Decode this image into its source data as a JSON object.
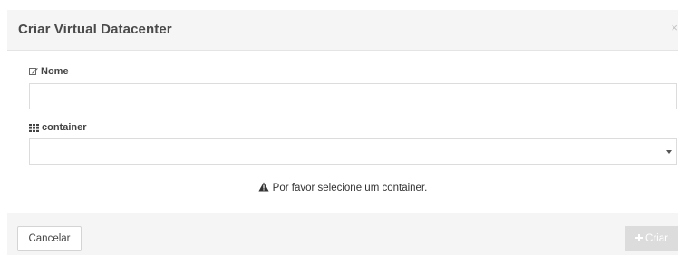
{
  "modal": {
    "title": "Criar Virtual Datacenter",
    "close_label": "×"
  },
  "form": {
    "name_field": {
      "label": "Nome",
      "icon": "edit-icon",
      "value": ""
    },
    "container_field": {
      "label": "container",
      "icon": "th-grid-icon",
      "selected_value": ""
    }
  },
  "warning": {
    "icon": "warning-triangle-icon",
    "text": "Por favor selecione um container."
  },
  "footer": {
    "cancel_label": "Cancelar",
    "create_label": "Criar",
    "create_icon": "plus-icon",
    "create_enabled": false
  },
  "colors": {
    "header_bg": "#f5f5f5",
    "footer_bg": "#f5f5f5",
    "border": "#dcdcdc",
    "disabled_button": "#dcdcdc"
  }
}
